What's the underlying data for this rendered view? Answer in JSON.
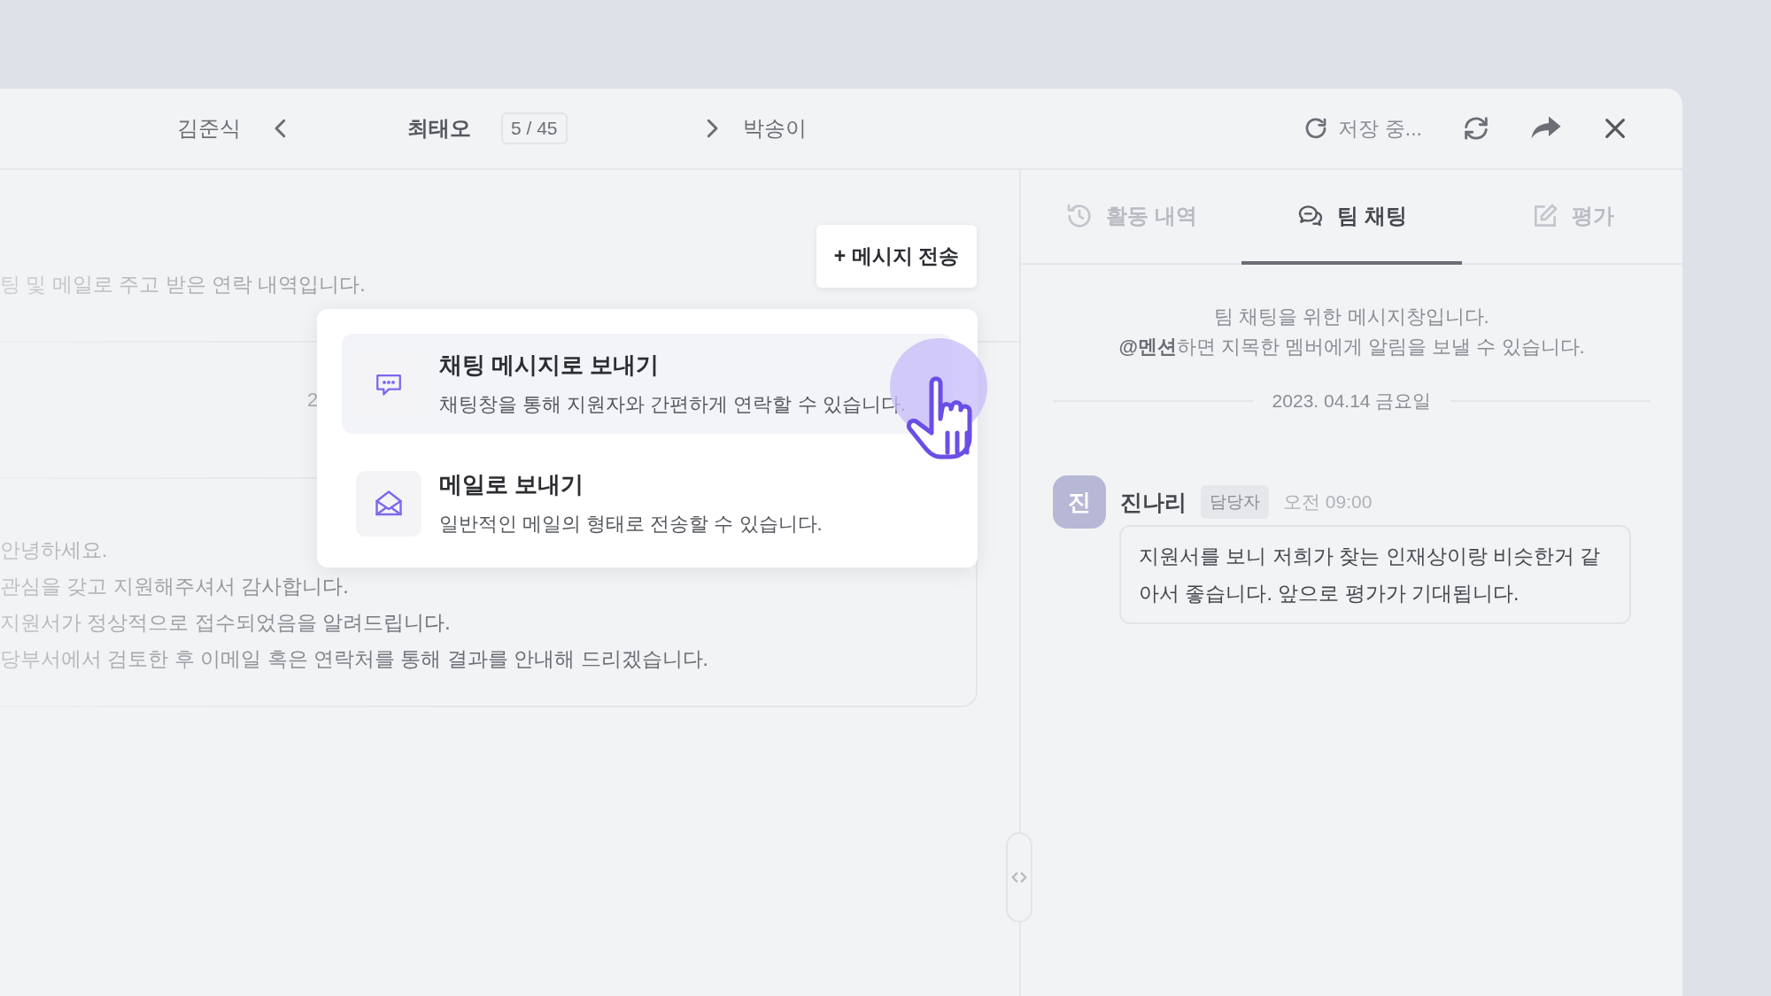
{
  "header": {
    "prev_name": "김준식",
    "current_name": "최태오",
    "position": "5 / 45",
    "next_name": "박송이",
    "save_status": "저장 중..."
  },
  "contact_history": {
    "description": "팅 및 메일로 주고 받은 연락 내역입니다.",
    "send_button": "+ 메시지 전송",
    "date_fragment": "2",
    "message_lines": [
      "안녕하세요.",
      "관심을 갖고 지원해주셔서 감사합니다.",
      "지원서가 정상적으로 접수되었음을 알려드립니다.",
      "당부서에서 검토한 후 이메일 혹은 연락처를 통해 결과를 안내해 드리겠습니다."
    ]
  },
  "send_menu": {
    "options": [
      {
        "kind": "chat",
        "title": "채팅 메시지로 보내기",
        "description": "채팅창을 통해 지원자와 간편하게 연락할 수 있습니다.",
        "selected": true
      },
      {
        "kind": "mail",
        "title": "메일로 보내기",
        "description": "일반적인 메일의 형태로 전송할 수 있습니다.",
        "selected": false
      }
    ]
  },
  "side_tabs": [
    {
      "kind": "history",
      "label": "활동 내역",
      "selected": false
    },
    {
      "kind": "chat",
      "label": "팀 채팅",
      "selected": true
    },
    {
      "kind": "review",
      "label": "평가",
      "selected": false
    }
  ],
  "team_chat": {
    "intro": [
      "팀 채팅을 위한 메시지창입니다.",
      "**@멘션**하면 지목한 멤버에게 알림을 보낼 수 있습니다."
    ],
    "date": "2023. 04.14 금요일",
    "messages": [
      {
        "avatar": "진",
        "author": "진나리",
        "role": "담당자",
        "time": "오전 09:00",
        "text": "지원서를 보니 저희가 찾는 인재상이랑 비슷한거 같아서 좋습니다. 앞으로 평가가 기대됩니다."
      }
    ]
  }
}
